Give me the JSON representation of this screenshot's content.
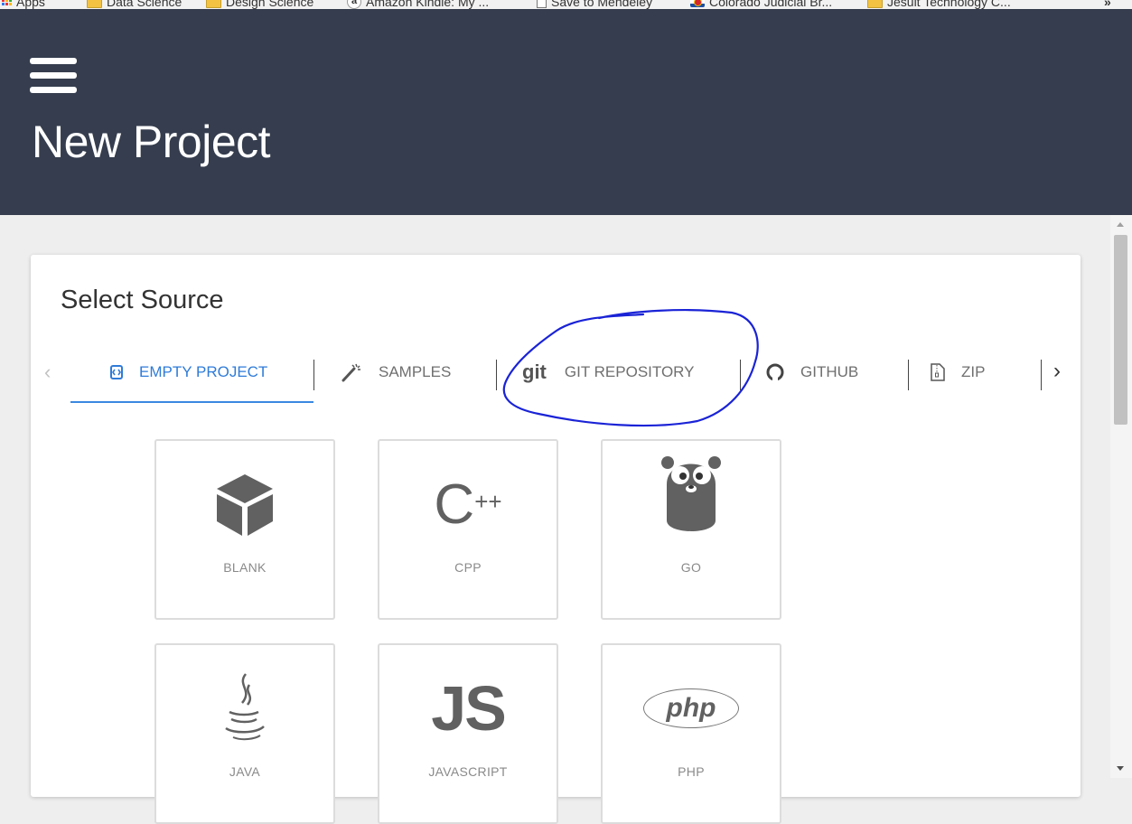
{
  "bookmarks": {
    "apps": "Apps",
    "items": [
      {
        "label": "Data Science",
        "icon": "folder-icon"
      },
      {
        "label": "Design Science",
        "icon": "folder-icon"
      },
      {
        "label": "Amazon Kindle: My ...",
        "icon": "amazon-icon"
      },
      {
        "label": "Save to Mendeley",
        "icon": "page-icon"
      },
      {
        "label": "Colorado Judicial Br...",
        "icon": "colorado-icon"
      },
      {
        "label": "Jesuit Technology C...",
        "icon": "folder-icon"
      }
    ],
    "overflow": "»"
  },
  "header": {
    "title": "New Project",
    "menu_icon": "hamburger-menu-icon",
    "background": "#353d4e"
  },
  "card": {
    "title": "Select Source",
    "tabs": [
      {
        "label": "EMPTY PROJECT",
        "icon": "codenvy-icon",
        "active": true
      },
      {
        "label": "SAMPLES",
        "icon": "magic-wand-icon",
        "active": false
      },
      {
        "label": "GIT REPOSITORY",
        "icon": "git-icon",
        "active": false,
        "icon_text": "git"
      },
      {
        "label": "GITHUB",
        "icon": "github-icon",
        "active": false
      },
      {
        "label": "ZIP",
        "icon": "zip-file-icon",
        "active": false
      }
    ],
    "tab_prev": "‹",
    "tab_next": "›",
    "accent": "#2f7bd8"
  },
  "templates": [
    {
      "label": "BLANK",
      "icon": "cube-icon"
    },
    {
      "label": "CPP",
      "icon": "cpp-icon",
      "icon_text": "C",
      "icon_sup": "++"
    },
    {
      "label": "GO",
      "icon": "gopher-icon"
    },
    {
      "label": "JAVA",
      "icon": "java-icon"
    },
    {
      "label": "JAVASCRIPT",
      "icon": "js-icon",
      "icon_text": "JS"
    },
    {
      "label": "PHP",
      "icon": "php-icon",
      "icon_text": "php"
    }
  ],
  "annotation": {
    "color": "#1a23d6",
    "shape": "hand-drawn-circle",
    "target": "GIT REPOSITORY"
  }
}
